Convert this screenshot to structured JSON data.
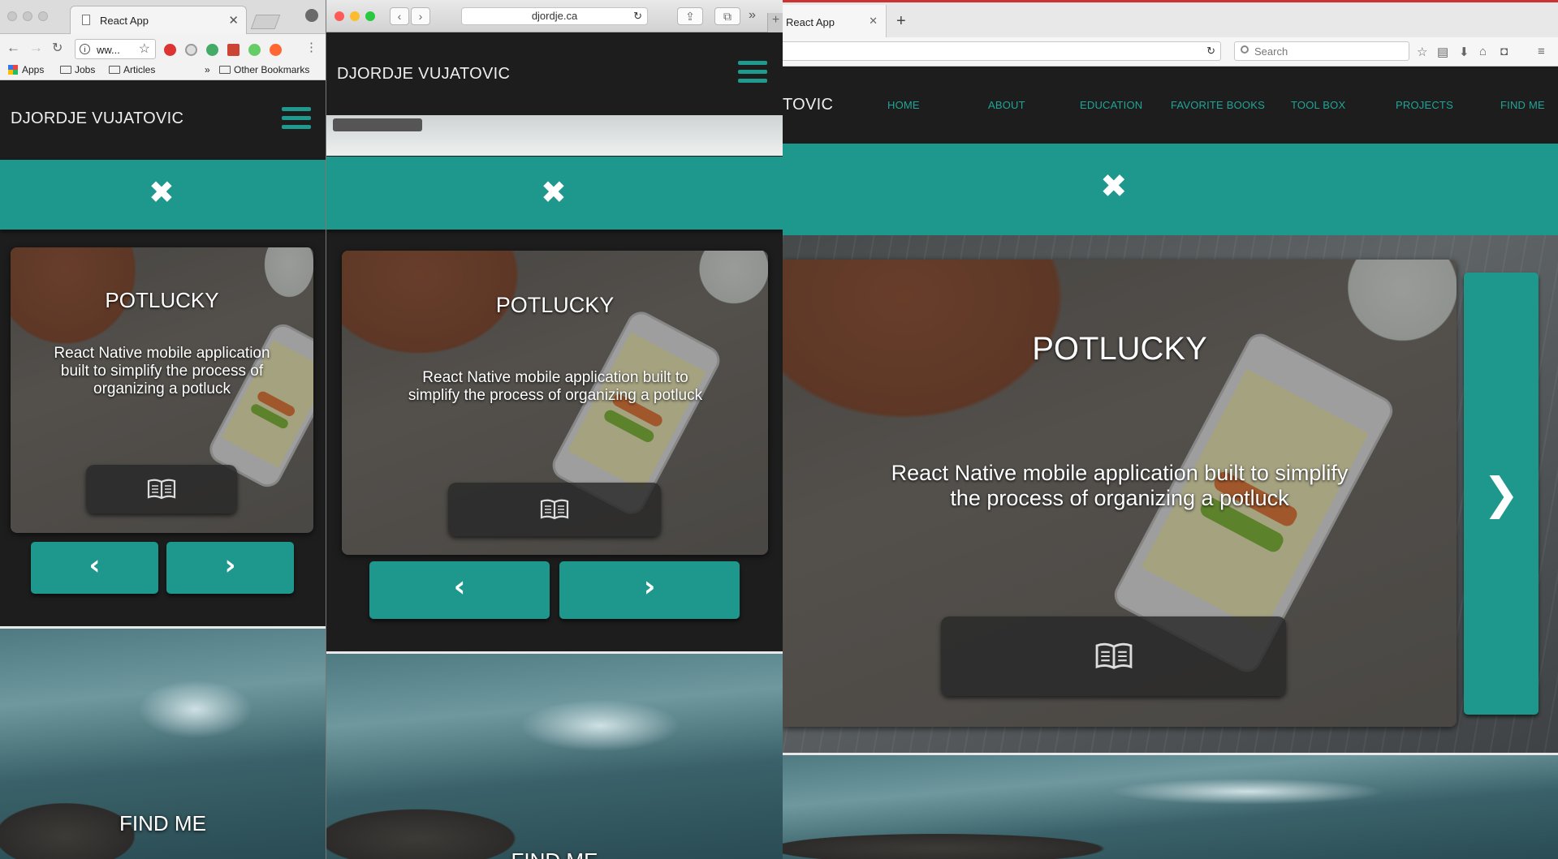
{
  "colors": {
    "accent": "#1e978c",
    "nav_bg": "#1d1d1d",
    "menu_text": "#1fa597"
  },
  "chrome": {
    "tab_title": "React App",
    "url_text": "ww...",
    "bookmarks": [
      "Apps",
      "Jobs",
      "Articles",
      "Other Bookmarks"
    ],
    "overflow": "»"
  },
  "safari": {
    "url": "djordje.ca",
    "overflow": "»"
  },
  "firefox": {
    "tab_title": "React App",
    "search_placeholder": "Search"
  },
  "site": {
    "brand": "DJORDJE VUJATOVIC",
    "brand_partial": "TOVIC",
    "menu": [
      "HOME",
      "ABOUT",
      "EDUCATION",
      "FAVORITE BOOKS",
      "TOOL BOX",
      "PROJECTS",
      "FIND ME"
    ],
    "close_glyph": "✖",
    "project": {
      "title": "POTLUCKY",
      "description": "React Native mobile application built to simplify the process of organizing a potluck"
    },
    "prev_glyph": "‹",
    "next_glyph": "›",
    "next_big_glyph": "❯",
    "section_title": "FIND ME",
    "icons": [
      "hamburger-icon",
      "close-icon",
      "book-icon",
      "chevron-left-icon",
      "chevron-right-icon"
    ]
  }
}
